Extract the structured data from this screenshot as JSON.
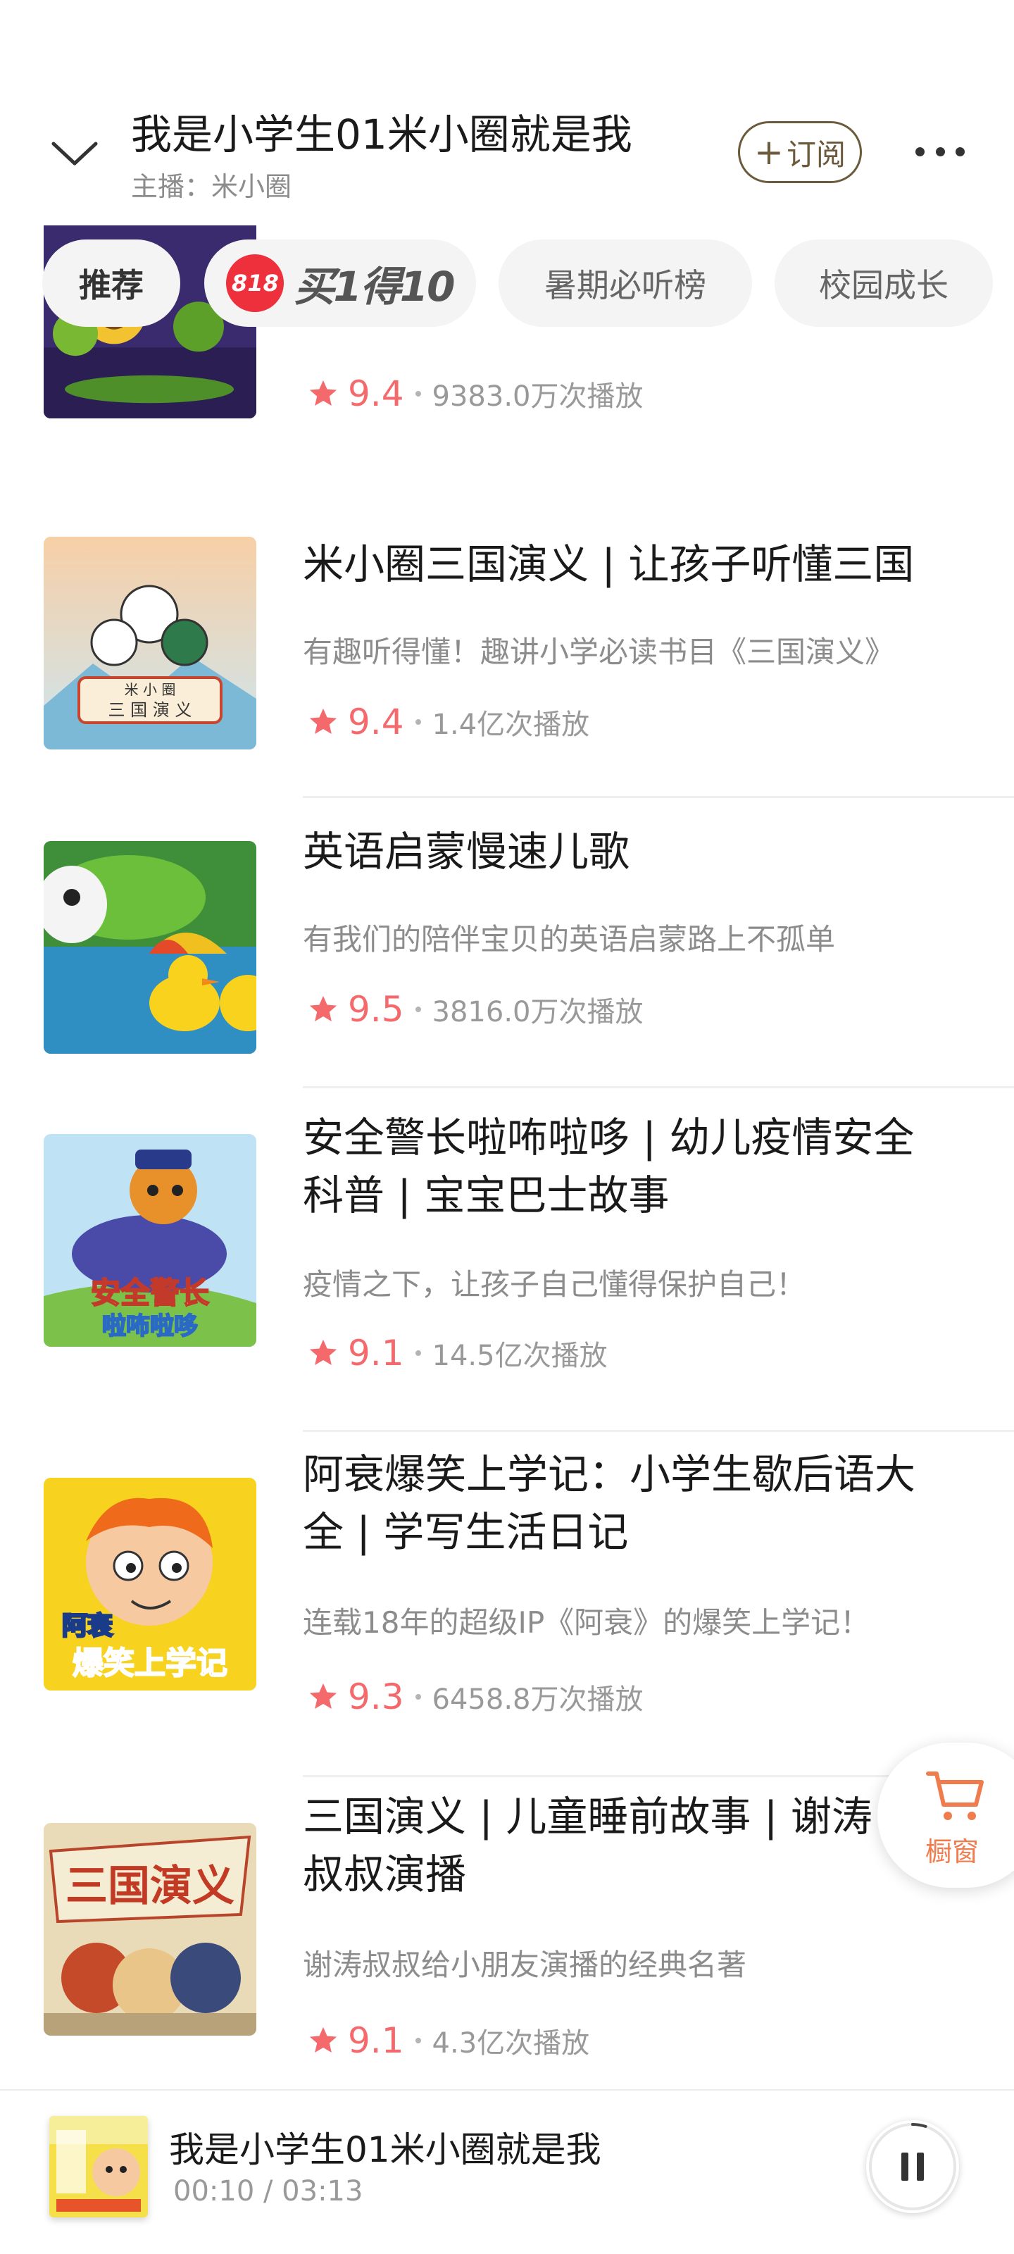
{
  "header": {
    "title": "我是小学生01米小圈就是我",
    "host": "主播：米小圈",
    "subscribe_label": "订阅"
  },
  "tabs": [
    {
      "label": "推荐"
    },
    {
      "badge": "818",
      "label": "买1得10"
    },
    {
      "label": "暑期必听榜"
    },
    {
      "label": "校园成长"
    }
  ],
  "items": [
    {
      "title": "",
      "desc": "",
      "rating": "9.4",
      "plays": "9383.0万次播放"
    },
    {
      "title": "米小圈三国演义 | 让孩子听懂三国",
      "desc": "有趣听得懂！趣讲小学必读书目《三国演义》",
      "rating": "9.4",
      "plays": "1.4亿次播放"
    },
    {
      "title": "英语启蒙慢速儿歌",
      "desc": "有我们的陪伴宝贝的英语启蒙路上不孤单",
      "rating": "9.5",
      "plays": "3816.0万次播放"
    },
    {
      "title": "安全警长啦咘啦哆 | 幼儿疫情安全科普 | 宝宝巴士故事",
      "desc": "疫情之下，让孩子自己懂得保护自己！",
      "rating": "9.1",
      "plays": "14.5亿次播放"
    },
    {
      "title": "阿衰爆笑上学记：小学生歇后语大全 | 学写生活日记",
      "desc": "连载18年的超级IP《阿衰》的爆笑上学记！",
      "rating": "9.3",
      "plays": "6458.8万次播放"
    },
    {
      "title": "三国演义 | 儿童睡前故事 | 谢涛叔叔演播",
      "desc": "谢涛叔叔给小朋友演播的经典名著",
      "rating": "9.1",
      "plays": "4.3亿次播放"
    }
  ],
  "cover_text": {
    "item1_line1": "米 小 圈",
    "item1_line2": "三 国 演 义",
    "item3_line1": "安全警长",
    "item3_line2": "啦咘啦哆",
    "item4_line1": "阿衰",
    "item4_line2": "爆笑上学记",
    "item5_line1": "三国演义"
  },
  "cart": {
    "label": "橱窗"
  },
  "player": {
    "title": "我是小学生01米小圈就是我",
    "time": "00:10 / 03:13",
    "progress": 0.05
  },
  "colors": {
    "accent_rating": "#f46a6c",
    "subscribe_border": "#6b5a3c",
    "cart": "#f07c4e",
    "promo_badge": "#ee2f3c"
  },
  "icons": {
    "back": "chevron-down-icon",
    "more": "more-dots-icon",
    "star": "star-icon",
    "cart": "cart-icon",
    "pause": "pause-icon"
  }
}
